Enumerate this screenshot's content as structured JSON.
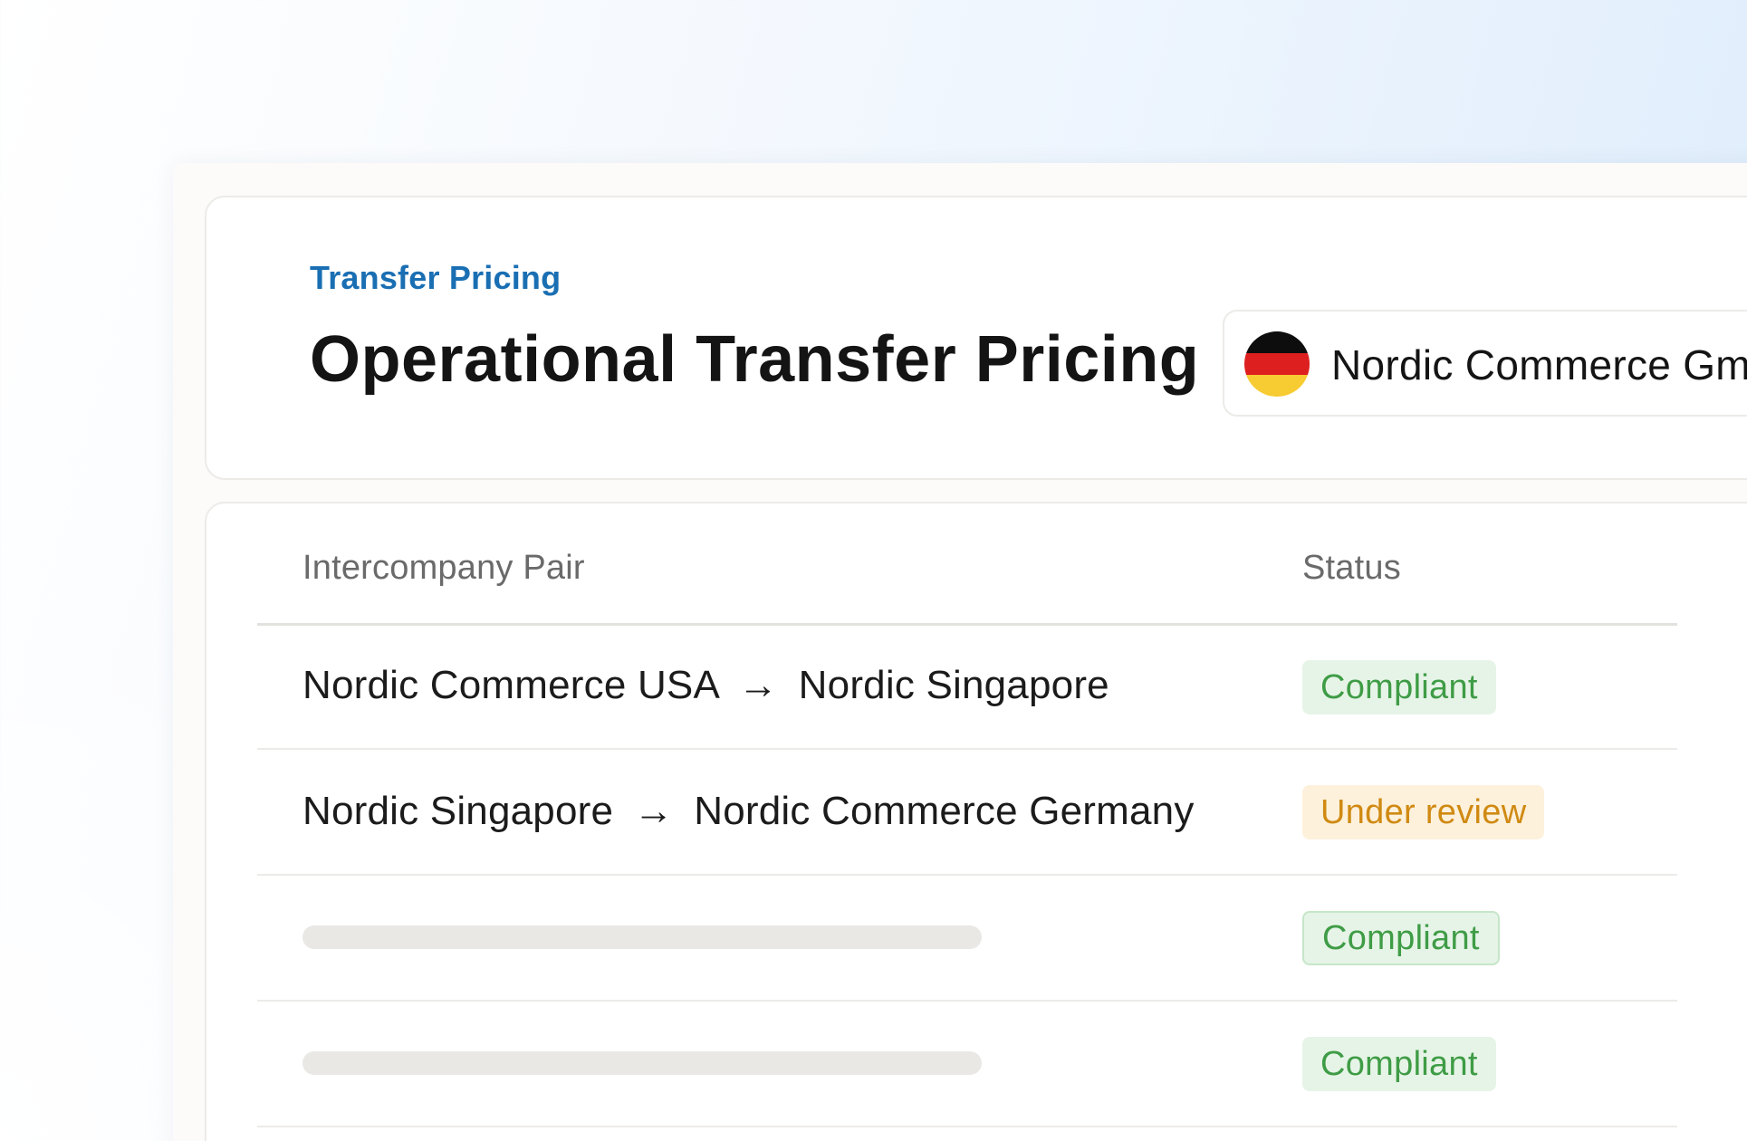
{
  "header": {
    "eyebrow": "Transfer Pricing",
    "title": "Operational Transfer Pricing",
    "entity_selector": {
      "flag_icon": "germany-flag-icon",
      "value": "Nordic Commerce Gm"
    }
  },
  "table": {
    "columns": [
      "Intercompany Pair",
      "Status"
    ],
    "rows": [
      {
        "from": "Nordic Commerce USA",
        "arrow": "→",
        "to": "Nordic Singapore",
        "status": "Compliant"
      },
      {
        "from": "Nordic Singapore",
        "arrow": "→",
        "to": "Nordic Commerce Germany",
        "status": "Under review"
      },
      {
        "from": "",
        "arrow": "",
        "to": "",
        "status": "Compliant"
      },
      {
        "from": "",
        "arrow": "",
        "to": "",
        "status": "Compliant"
      }
    ]
  },
  "colors": {
    "accent_blue": "#1a6fb3",
    "compliant_text": "#3f9c46",
    "compliant_bg": "#e6f4e7",
    "review_text": "#d08a12",
    "review_bg": "#fdf1dc"
  }
}
